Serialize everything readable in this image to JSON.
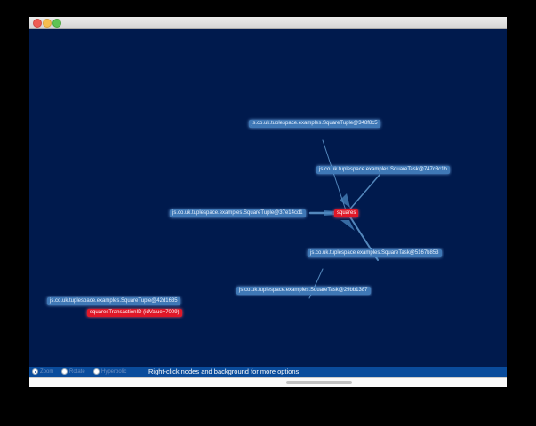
{
  "graph": {
    "nodes": {
      "tuple_348": "js.co.uk.tuplespace.examples.SquareTuple@348f8c5",
      "task_747": "js.co.uk.tuplespace.examples.SquareTask@747c8c1b",
      "tuple_37e": "js.co.uk.tuplespace.examples.SquareTuple@37e14cd1",
      "squares": "squares",
      "task_5167": "js.co.uk.tuplespace.examples.SquareTask@5167b853",
      "task_29b": "js.co.uk.tuplespace.examples.SquareTask@29bb1387",
      "tuple_42d": "js.co.uk.tuplespace.examples.SquareTuple@42d1635",
      "transaction": "squaresTransactionID (idValue=7009)"
    }
  },
  "controls": {
    "options": [
      "Zoom",
      "Rotate",
      "Hyperbolic"
    ],
    "selected": "Zoom",
    "hint": "Right-click nodes and background for more options"
  },
  "colors": {
    "canvas_background": "#001a4d",
    "node_blue": "#3f78b6",
    "node_red": "#e01828",
    "controls_bar": "#0a4c9c"
  }
}
